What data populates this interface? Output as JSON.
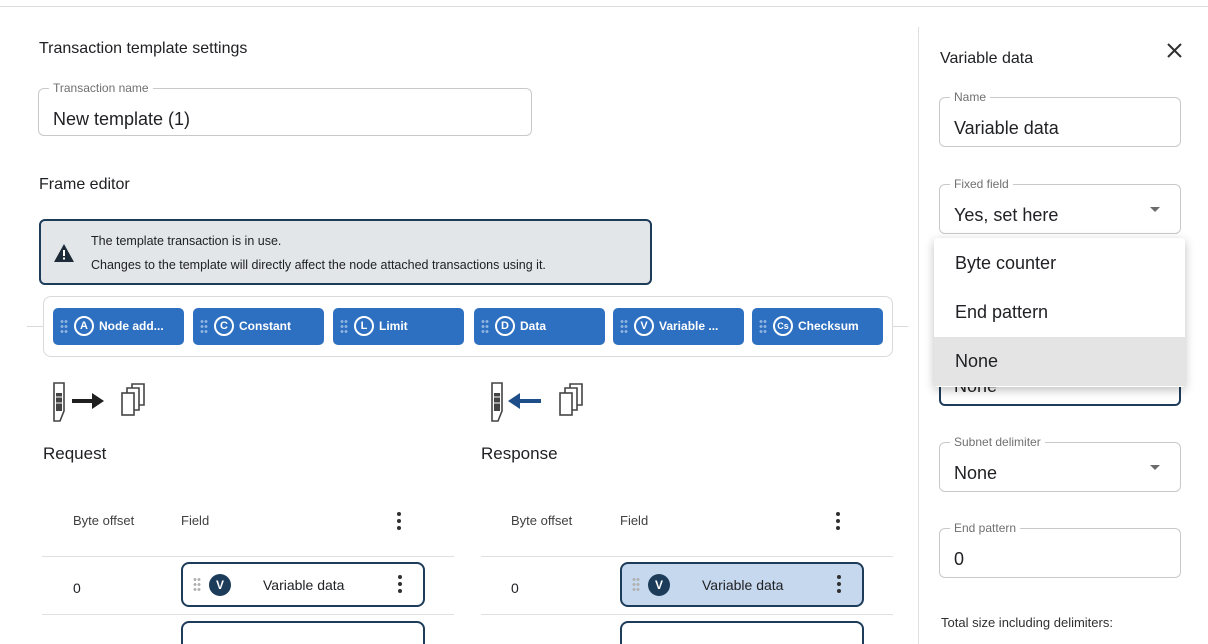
{
  "settings": {
    "title": "Transaction template settings",
    "transaction_name_label": "Transaction name",
    "transaction_name_value": "New template (1)",
    "frame_editor_title": "Frame editor"
  },
  "banner": {
    "line1": "The template transaction is in use.",
    "line2": "Changes to the template will directly affect the node attached transactions using it."
  },
  "palette": [
    {
      "symbol": "A",
      "label": "Node add..."
    },
    {
      "symbol": "C",
      "label": "Constant"
    },
    {
      "symbol": "L",
      "label": "Limit"
    },
    {
      "symbol": "D",
      "label": "Data"
    },
    {
      "symbol": "V",
      "label": "Variable ..."
    },
    {
      "symbol": "Cs",
      "label": "Checksum"
    }
  ],
  "request": {
    "title": "Request",
    "col_offset": "Byte offset",
    "col_field": "Field",
    "rows": [
      {
        "offset": "0",
        "badge": "V",
        "field": "Variable data"
      }
    ]
  },
  "response": {
    "title": "Response",
    "col_offset": "Byte offset",
    "col_field": "Field",
    "rows": [
      {
        "offset": "0",
        "badge": "V",
        "field": "Variable data"
      }
    ]
  },
  "panel": {
    "title": "Variable data",
    "name_label": "Name",
    "name_value": "Variable data",
    "fixed_field_label": "Fixed field",
    "fixed_field_value": "Yes, set here",
    "hidden_select_value": "None",
    "subnet_delimiter_label": "Subnet delimiter",
    "subnet_delimiter_value": "None",
    "end_pattern_label": "End pattern",
    "end_pattern_value": "0",
    "footer_text": "Total size including delimiters:"
  },
  "dropdown_options": [
    "Byte counter",
    "End pattern",
    "None"
  ],
  "colors": {
    "chip": "#2d6fc0",
    "navy": "#1d3c5a",
    "selected_row": "#c5d8ee"
  }
}
